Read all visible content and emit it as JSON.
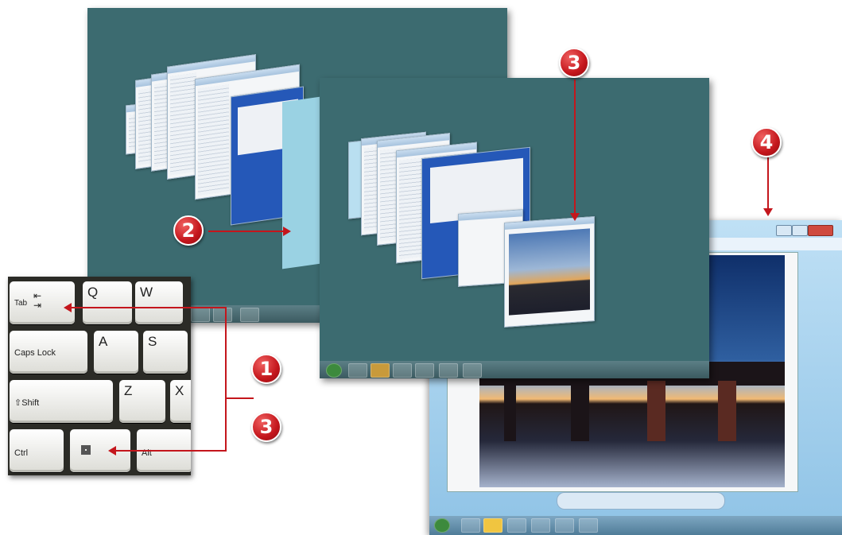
{
  "callouts": {
    "one": "1",
    "two": "2",
    "three_top": "3",
    "three_bottom": "3",
    "four": "4"
  },
  "keyboard": {
    "tab": "Tab",
    "q": "Q",
    "w": "W",
    "caps_lock": "Caps Lock",
    "a": "A",
    "s": "S",
    "shift": "⇧Shift",
    "z": "Z",
    "x": "X",
    "ctrl": "Ctrl",
    "alt": "Alt"
  },
  "colors": {
    "desktop": "#3c6b70",
    "callout": "#c4161c",
    "viewer_frame": "#8fc3e6"
  },
  "icons": {
    "tab_arrows": "tab-arrows-icon",
    "windows_key": "windows-logo-icon",
    "close": "close-icon"
  }
}
